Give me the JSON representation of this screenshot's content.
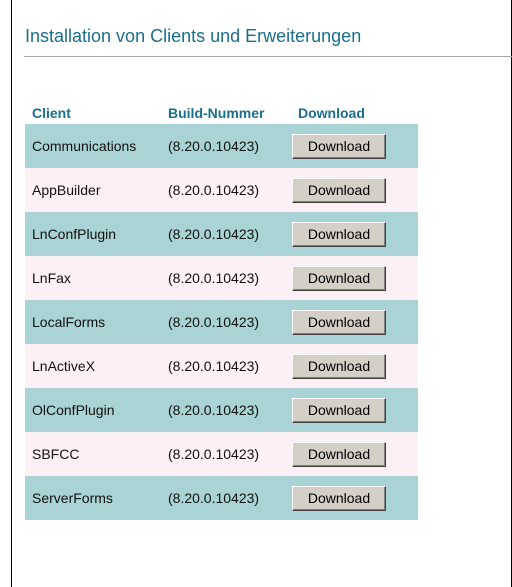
{
  "page": {
    "title": "Installation von Clients und Erweiterungen"
  },
  "table": {
    "headers": [
      "Client",
      "Build-Nummer",
      "Download"
    ],
    "rows": [
      {
        "client": "Communications",
        "build": "(8.20.0.10423)",
        "button": "Download"
      },
      {
        "client": "AppBuilder",
        "build": "(8.20.0.10423)",
        "button": "Download"
      },
      {
        "client": "LnConfPlugin",
        "build": "(8.20.0.10423)",
        "button": "Download"
      },
      {
        "client": "LnFax",
        "build": "(8.20.0.10423)",
        "button": "Download"
      },
      {
        "client": "LocalForms",
        "build": "(8.20.0.10423)",
        "button": "Download"
      },
      {
        "client": "LnActiveX",
        "build": "(8.20.0.10423)",
        "button": "Download"
      },
      {
        "client": "OlConfPlugin",
        "build": "(8.20.0.10423)",
        "button": "Download"
      },
      {
        "client": "SBFCC",
        "build": "(8.20.0.10423)",
        "button": "Download"
      },
      {
        "client": "ServerForms",
        "build": "(8.20.0.10423)",
        "button": "Download"
      }
    ]
  },
  "colors": {
    "accent": "#1a6e8e",
    "row_alt_a": "#a9d3d4",
    "row_alt_b": "#fdf0f5"
  }
}
